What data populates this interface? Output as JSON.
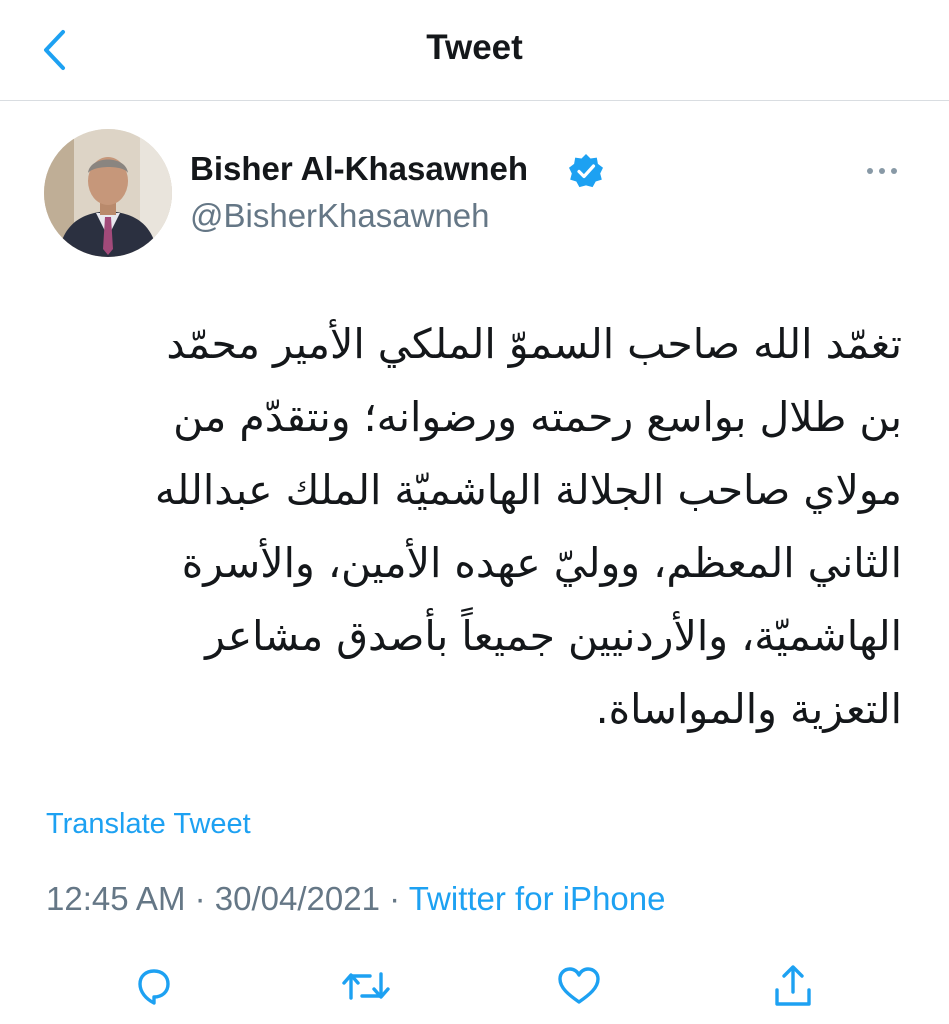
{
  "header": {
    "title": "Tweet",
    "back_icon": "chevron-left-icon"
  },
  "colors": {
    "accent": "#1da1f2",
    "text": "#14171a",
    "secondary": "#657786",
    "divider": "#d9dde1"
  },
  "author": {
    "name": "Bisher Al-Khasawneh",
    "handle": "@BisherKhasawneh",
    "verified_icon": "verified-badge-icon",
    "more_icon": "more-horizontal-icon"
  },
  "tweet": {
    "text": "تغمّد الله صاحب السموّ الملكي الأمير محمّد\nبن طلال بواسع رحمته ورضوانه؛ ونتقدّم من\nمولاي صاحب الجلالة الهاشميّة الملك عبدالله\nالثاني المعظم، ووليّ عهده الأمين، والأسرة\nالهاشميّة، والأردنيين جميعاً بأصدق مشاعر\nالتعزية والمواساة.",
    "translate_label": "Translate Tweet",
    "time": "12:45 AM",
    "date": "30/04/2021",
    "separator": "·",
    "source": "Twitter for iPhone"
  },
  "actions": [
    {
      "name": "reply",
      "icon": "reply-icon"
    },
    {
      "name": "retweet",
      "icon": "retweet-icon"
    },
    {
      "name": "like",
      "icon": "heart-icon"
    },
    {
      "name": "share",
      "icon": "share-icon"
    }
  ]
}
